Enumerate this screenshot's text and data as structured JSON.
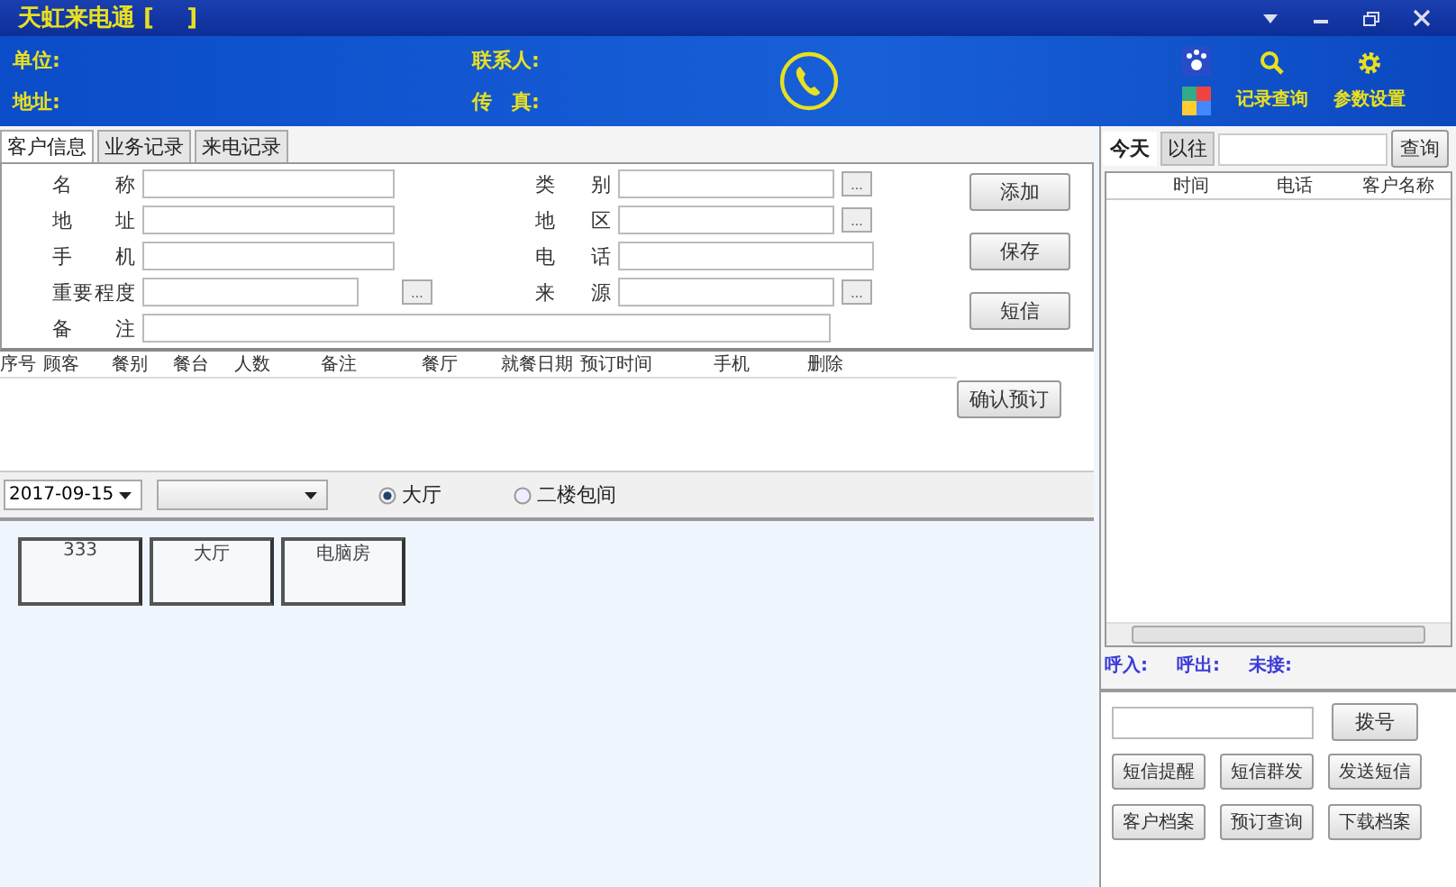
{
  "window": {
    "title": "天虹来电通 [    ]"
  },
  "header": {
    "fields_left": [
      "单位:",
      "地址:"
    ],
    "fields_right": [
      "联系人:",
      "传　真:"
    ],
    "tools": [
      {
        "label": "记录查询",
        "kind": "search"
      },
      {
        "label": "参数设置",
        "kind": "gear"
      }
    ]
  },
  "tabs": [
    {
      "label": "客户信息",
      "selected": true
    },
    {
      "label": "业务记录",
      "selected": false
    },
    {
      "label": "来电记录",
      "selected": false
    }
  ],
  "form": {
    "left": [
      {
        "label": "名称",
        "picker": false
      },
      {
        "label": "地址",
        "picker": false
      },
      {
        "label": "手机",
        "picker": false
      },
      {
        "label": "重要程度",
        "picker": true
      }
    ],
    "right": [
      {
        "label": "类别",
        "picker": true
      },
      {
        "label": "地区",
        "picker": true
      },
      {
        "label": "电话",
        "picker": false
      },
      {
        "label": "来源",
        "picker": true
      }
    ],
    "note_label": "备注",
    "picker_button": "...",
    "actions": [
      "添加",
      "保存",
      "短信"
    ]
  },
  "booking_table": {
    "columns": [
      "序号",
      "顾客",
      "餐别",
      "餐台",
      "人数",
      "备注",
      "餐厅",
      "就餐日期",
      "预订时间",
      "手机",
      "删除"
    ],
    "confirm_button": "确认预订"
  },
  "filter": {
    "date": "2017-09-15",
    "radios": [
      {
        "label": "大厅",
        "selected": true
      },
      {
        "label": "二楼包间",
        "selected": false
      }
    ]
  },
  "rooms": [
    "333",
    "大厅",
    "电脑房"
  ],
  "calls": {
    "tabs": [
      {
        "label": "今天",
        "selected": true
      },
      {
        "label": "以往",
        "selected": false
      }
    ],
    "search_button": "查询",
    "columns": [
      "时间",
      "电话",
      "客户名称"
    ],
    "stats": [
      "呼入:",
      "呼出:",
      "未接:"
    ],
    "dial_button": "拨号",
    "buttons": [
      "短信提醒",
      "短信群发",
      "发送短信",
      "客户档案",
      "预订查询",
      "下载档案"
    ]
  }
}
